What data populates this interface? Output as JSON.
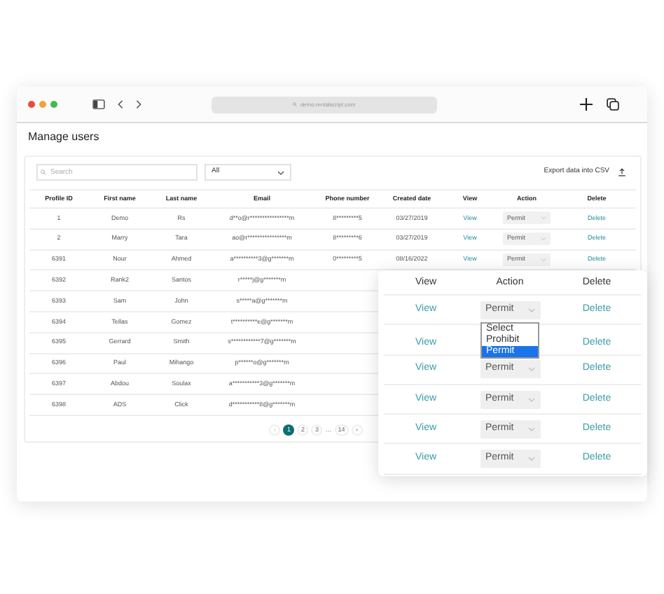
{
  "browser": {
    "address": "demo.rentalscript.com"
  },
  "page": {
    "title": "Manage users"
  },
  "toolbar": {
    "search": {
      "placeholder": "Search"
    },
    "filter": {
      "value": "All"
    },
    "export": "Export data into CSV"
  },
  "table": {
    "columns": [
      "Profile ID",
      "First name",
      "Last name",
      "Email",
      "Phone number",
      "Created date",
      "View",
      "Action",
      "Delete"
    ],
    "rows": [
      {
        "id": "1",
        "first": "Demo",
        "last": "Rs",
        "email": "d**o@r****************m",
        "phone": "8*********5",
        "created": "03/27/2019",
        "view": "View",
        "action": "Permit",
        "delete": "Delete"
      },
      {
        "id": "2",
        "first": "Marry",
        "last": "Tara",
        "email": "ao@r****************m",
        "phone": "8*********6",
        "created": "03/27/2019",
        "view": "View",
        "action": "Permit",
        "delete": "Delete"
      },
      {
        "id": "6391",
        "first": "Nour",
        "last": "Ahmed",
        "email": "a**********3@g*******m",
        "phone": "0*********5",
        "created": "08/16/2022",
        "view": "View",
        "action": "Permit",
        "delete": "Delete"
      },
      {
        "id": "6392",
        "first": "Rank2",
        "last": "Santos",
        "email": "r*****j@g*******m"
      },
      {
        "id": "6393",
        "first": "Sam",
        "last": "John",
        "email": "s*****a@g*******m"
      },
      {
        "id": "6394",
        "first": "Tellas",
        "last": "Gomez",
        "email": "t**********e@g*******m"
      },
      {
        "id": "6395",
        "first": "Gerrard",
        "last": "Smith",
        "email": "s************7@g*******m"
      },
      {
        "id": "6396",
        "first": "Paul",
        "last": "Mihango",
        "email": "p******o@g*******m"
      },
      {
        "id": "6397",
        "first": "Abdou",
        "last": "Soulax",
        "email": "a***********3@g*******m"
      },
      {
        "id": "6398",
        "first": "ADS",
        "last": "Click",
        "email": "d***********8@g*******m"
      }
    ]
  },
  "pagination": {
    "prev": "‹",
    "pages": [
      {
        "label": "1",
        "selected": true
      },
      {
        "label": "2",
        "selected": false
      },
      {
        "label": "3",
        "selected": false
      }
    ],
    "ellipsis": "…",
    "last": {
      "label": "14",
      "selected": false
    },
    "next": "›"
  },
  "zoom_panel": {
    "columns": [
      "View",
      "Action",
      "Delete"
    ],
    "rows": [
      {
        "view": "View",
        "action": "Permit",
        "delete": "Delete",
        "expanded": false
      },
      {
        "view": "View",
        "delete": "Delete",
        "expanded": true,
        "options": [
          {
            "label": "Select",
            "selected": false
          },
          {
            "label": "Prohibit",
            "selected": false
          },
          {
            "label": "Permit",
            "selected": true
          }
        ]
      },
      {
        "view": "View",
        "action": "Permit",
        "delete": "Delete",
        "expanded": false
      },
      {
        "view": "View",
        "action": "Permit",
        "delete": "Delete",
        "expanded": false
      },
      {
        "view": "View",
        "action": "Permit",
        "delete": "Delete",
        "expanded": false
      },
      {
        "view": "View",
        "action": "Permit",
        "delete": "Delete",
        "expanded": false
      }
    ]
  }
}
